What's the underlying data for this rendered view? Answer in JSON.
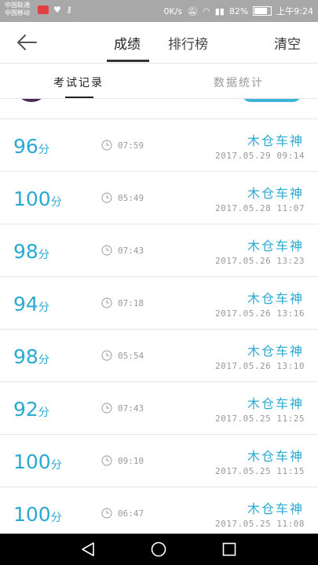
{
  "statusbar": {
    "carrier1": "中国联通",
    "carrier2": "中国移动",
    "network_speed": "0K/s",
    "battery": "82%",
    "time": "上午9:24"
  },
  "header": {
    "tab_scores": "成绩",
    "tab_ranking": "排行榜",
    "clear_label": "清空"
  },
  "subtabs": {
    "exam_records": "考试记录",
    "statistics": "数据统计"
  },
  "records": [
    {
      "score": "96",
      "unit": "分",
      "duration": "07:59",
      "user": "木仓车神",
      "date": "2017.05.29  09:14"
    },
    {
      "score": "100",
      "unit": "分",
      "duration": "05:49",
      "user": "木仓车神",
      "date": "2017.05.28  11:07"
    },
    {
      "score": "98",
      "unit": "分",
      "duration": "07:43",
      "user": "木仓车神",
      "date": "2017.05.26  13:23"
    },
    {
      "score": "94",
      "unit": "分",
      "duration": "07:18",
      "user": "木仓车神",
      "date": "2017.05.26  13:16"
    },
    {
      "score": "98",
      "unit": "分",
      "duration": "05:54",
      "user": "木仓车神",
      "date": "2017.05.26  13:10"
    },
    {
      "score": "92",
      "unit": "分",
      "duration": "07:43",
      "user": "木仓车神",
      "date": "2017.05.25  11:25"
    },
    {
      "score": "100",
      "unit": "分",
      "duration": "09:10",
      "user": "木仓车神",
      "date": "2017.05.25  11:15"
    },
    {
      "score": "100",
      "unit": "分",
      "duration": "06:47",
      "user": "木仓车神",
      "date": "2017.05.25  11:08"
    }
  ],
  "colors": {
    "accent": "#2aa9d2",
    "statusbar": "#a8a8a8",
    "navbar": "#000000"
  }
}
